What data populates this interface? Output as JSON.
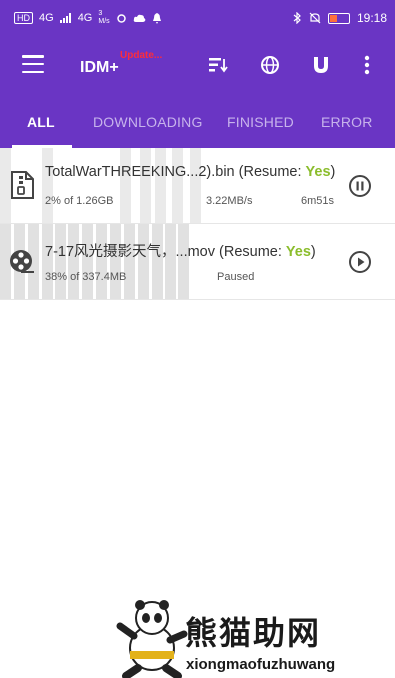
{
  "status_bar": {
    "left_chip": "HD",
    "signal_1": "4G",
    "signal_2": "4G",
    "speed_value": "3",
    "speed_unit": "M/s",
    "time": "19:18"
  },
  "toolbar": {
    "title": "IDM+",
    "update_badge": "Update..."
  },
  "tabs": [
    {
      "label": "ALL"
    },
    {
      "label": "DOWNLOADING"
    },
    {
      "label": "FINISHED"
    },
    {
      "label": "ERROR"
    }
  ],
  "downloads": [
    {
      "name": "TotalWarTHREEKING...2).bin (Resume: ",
      "resume": "Yes",
      "close": ")",
      "size": "2% of 1.26GB",
      "speed": "3.22MB/s",
      "eta": "6m51s",
      "progress": 0.02,
      "file_icon": "archive-file-icon",
      "action_icon": "pause-icon"
    },
    {
      "name": "7-17风光摄影天气，...mov (Resume: ",
      "resume": "Yes",
      "close": ")",
      "size": "38% of 337.4MB",
      "status": "Paused",
      "progress": 0.38,
      "file_icon": "video-reel-icon",
      "action_icon": "play-icon"
    }
  ],
  "watermark": {
    "cn": "熊猫助网",
    "en": "xiongmaofuzhuwang"
  },
  "colors": {
    "primary": "#6a35c4",
    "tab_inactive": "#c7b3ec",
    "accent_yes": "#8bbd2c",
    "update_red": "#ff2b3a"
  }
}
